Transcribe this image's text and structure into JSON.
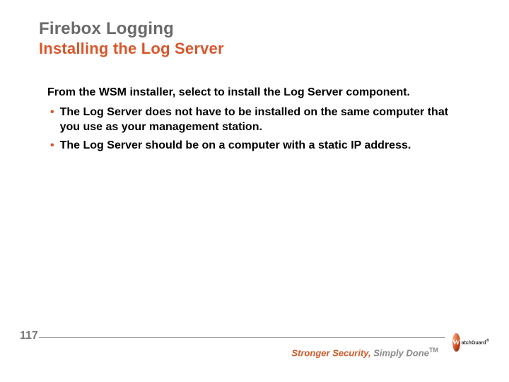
{
  "header": {
    "title": "Firebox Logging",
    "subtitle": "Installing the Log Server"
  },
  "content": {
    "intro": "From the WSM installer, select to install the Log Server component.",
    "bullets": [
      "The Log Server does not have to be installed on the same computer that you use as your management station.",
      "The Log Server should be on a computer with a static IP address."
    ]
  },
  "footer": {
    "page": "117",
    "tagline_strong": "Stronger Security, ",
    "tagline_gray": "Simply Done",
    "tagline_tm": "TM",
    "logo_text": "atchGuard",
    "logo_r": "®"
  }
}
